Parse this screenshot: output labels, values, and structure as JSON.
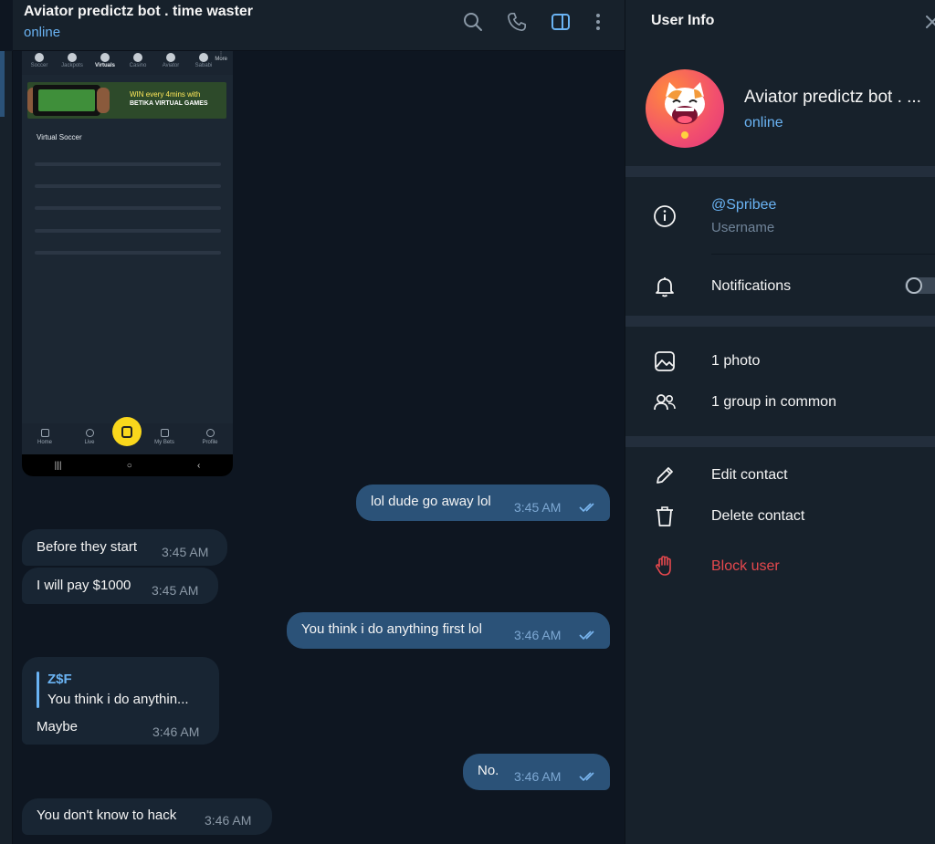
{
  "chat": {
    "title": "Aviator predictz bot . time waster",
    "status": "online"
  },
  "header_icons": [
    "search-icon",
    "phone-icon",
    "sidebar-toggle-icon",
    "more-vertical-icon"
  ],
  "screenshot": {
    "tabs": [
      "Soccer",
      "Jackpots",
      "Virtuals",
      "Casino",
      "Aviator",
      "Sababi"
    ],
    "more_label": "More",
    "banner_line1": "WIN every 4mins with",
    "banner_line2": "BETIKA VIRTUAL GAMES",
    "section_title": "Virtual Soccer",
    "bottom_nav": [
      "Home",
      "Live",
      "My Bets",
      "Profile"
    ]
  },
  "messages": [
    {
      "direction": "out",
      "text": "lol dude go away lol",
      "time": "3:45 AM"
    },
    {
      "direction": "in",
      "text": "Before they start",
      "time": "3:45 AM"
    },
    {
      "direction": "in",
      "text": "I will pay $1000",
      "time": "3:45 AM"
    },
    {
      "direction": "out",
      "text": "You think i do anything first lol",
      "time": "3:46 AM"
    },
    {
      "direction": "in",
      "reply_name": "Z$F",
      "reply_text": "You think i do anythin...",
      "text": "Maybe",
      "time": "3:46 AM"
    },
    {
      "direction": "out",
      "text": "No.",
      "time": "3:46 AM"
    },
    {
      "direction": "in",
      "text": "You don't know to hack",
      "time": "3:46 AM"
    }
  ],
  "panel": {
    "title": "User Info",
    "name": "Aviator predictz bot . ...",
    "status": "online",
    "username": "@Spribee",
    "username_caption": "Username",
    "notifications_label": "Notifications",
    "notifications_enabled": false,
    "photos_label": "1 photo",
    "groups_label": "1 group in common",
    "edit_label": "Edit contact",
    "delete_label": "Delete contact",
    "block_label": "Block user"
  },
  "colors": {
    "accent": "#6ab3f3",
    "outgoing_bubble": "#2b5278",
    "incoming_bubble": "#182533",
    "danger": "#e5484d",
    "background": "#0e1621",
    "panel": "#17212b"
  }
}
